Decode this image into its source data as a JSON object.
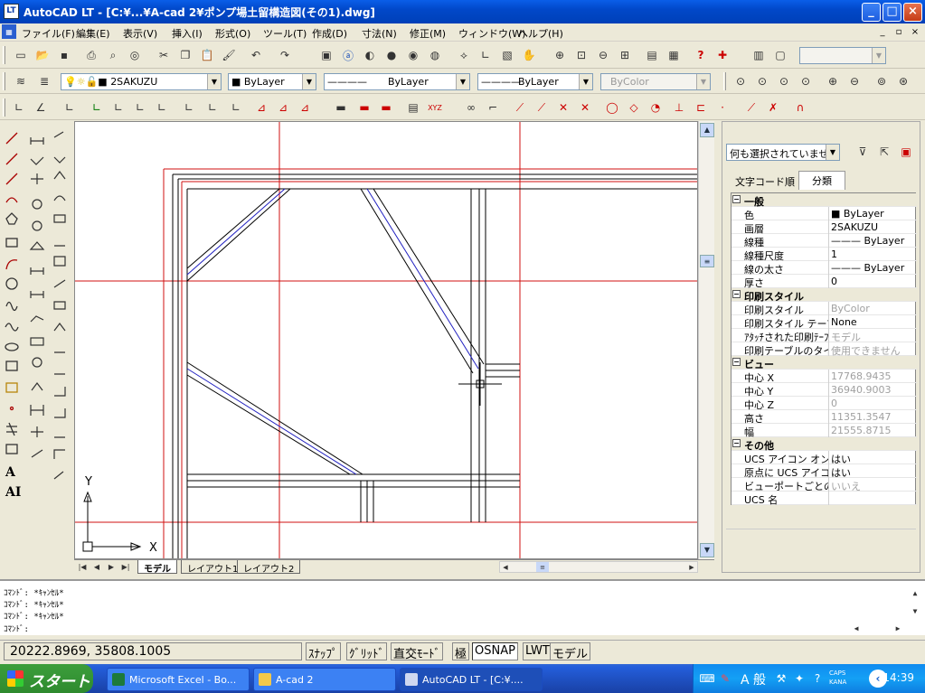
{
  "window": {
    "title": "AutoCAD LT - [C:¥...¥A-cad 2¥ポンプ場土留構造図(その1).dwg]",
    "app_icon_text": "LT",
    "buttons": [
      "_",
      "□",
      "×"
    ]
  },
  "menu": {
    "items": [
      "ファイル(F)",
      "編集(E)",
      "表示(V)",
      "挿入(I)",
      "形式(O)",
      "ツール(T)",
      "作成(D)",
      "寸法(N)",
      "修正(M)",
      "ウィンドウ(W)",
      "ヘルプ(H)"
    ],
    "mdi_buttons": [
      "_",
      "▫",
      "×"
    ]
  },
  "toolbar": {
    "layer_value": "2SAKUZU",
    "color_value": "ByLayer",
    "linetype_value": "ByLayer",
    "lineweight_value": "ByLayer",
    "plotstyle_value": "ByColor"
  },
  "canvas": {
    "ucs_y_label": "Y",
    "ucs_x_label": "X"
  },
  "layout_tabs": [
    "モデル",
    "レイアウト1",
    "レイアウト2"
  ],
  "properties": {
    "selection": "何も選択されていません",
    "tabs": [
      "文字コード順",
      "分類"
    ],
    "rows": [
      {
        "type": "cat",
        "key": "一般",
        "value": ""
      },
      {
        "type": "row",
        "key": "色",
        "value": "■ ByLayer",
        "gray": false
      },
      {
        "type": "row",
        "key": "画層",
        "value": "2SAKUZU",
        "gray": false
      },
      {
        "type": "row",
        "key": "線種",
        "value": "——— ByLayer",
        "gray": false
      },
      {
        "type": "row",
        "key": "線種尺度",
        "value": "1",
        "gray": false
      },
      {
        "type": "row",
        "key": "線の太さ",
        "value": "——— ByLayer",
        "gray": false
      },
      {
        "type": "row",
        "key": "厚さ",
        "value": "0",
        "gray": false
      },
      {
        "type": "cat",
        "key": "印刷スタイル",
        "value": ""
      },
      {
        "type": "row",
        "key": "印刷スタイル",
        "value": "ByColor",
        "gray": true
      },
      {
        "type": "row",
        "key": "印刷スタイル テーブル",
        "value": "None",
        "gray": false
      },
      {
        "type": "row",
        "key": "ｱﾀｯﾁされた印刷ﾃｰﾌﾞﾙ",
        "value": "モデル",
        "gray": true
      },
      {
        "type": "row",
        "key": "印刷テーブルのタイプ",
        "value": "使用できません",
        "gray": true
      },
      {
        "type": "cat",
        "key": "ビュー",
        "value": ""
      },
      {
        "type": "row",
        "key": "中心 X",
        "value": "17768.9435",
        "gray": true
      },
      {
        "type": "row",
        "key": "中心 Y",
        "value": "36940.9003",
        "gray": true
      },
      {
        "type": "row",
        "key": "中心 Z",
        "value": "0",
        "gray": true
      },
      {
        "type": "row",
        "key": "高さ",
        "value": "11351.3547",
        "gray": true
      },
      {
        "type": "row",
        "key": "幅",
        "value": "21555.8715",
        "gray": true
      },
      {
        "type": "cat",
        "key": "その他",
        "value": ""
      },
      {
        "type": "row",
        "key": "UCS アイコン オン",
        "value": "はい",
        "gray": false
      },
      {
        "type": "row",
        "key": "原点に UCS アイコン",
        "value": "はい",
        "gray": false
      },
      {
        "type": "row",
        "key": "ビューポートごとの UCS",
        "value": "いいえ",
        "gray": true
      },
      {
        "type": "row",
        "key": "UCS 名",
        "value": "",
        "gray": false
      }
    ]
  },
  "command": {
    "lines": [
      "ｺﾏﾝﾄﾞ: *ｷｬﾝｾﾙ*",
      "ｺﾏﾝﾄﾞ: *ｷｬﾝｾﾙ*",
      "ｺﾏﾝﾄﾞ: *ｷｬﾝｾﾙ*"
    ],
    "prompt": "ｺﾏﾝﾄﾞ:"
  },
  "status": {
    "coords": "20222.8969, 35808.1005",
    "buttons": [
      "ｽﾅｯﾌﾟ",
      "ｸﾞﾘｯﾄﾞ",
      "直交ﾓｰﾄﾞ",
      "極",
      "OSNAP",
      "LWT",
      "モデル"
    ]
  },
  "taskbar": {
    "start": "スタート",
    "tasks": [
      "Microsoft Excel - Bo...",
      "A-cad 2",
      "AutoCAD LT - [C:¥...."
    ],
    "ime": "A 般",
    "caps": "CAPS KANA",
    "clock": "14:39"
  },
  "colors": {
    "titlebar": "#0148c9",
    "construction_line": "#d01010",
    "wall_line": "#000000",
    "center_line": "#2020c0"
  }
}
